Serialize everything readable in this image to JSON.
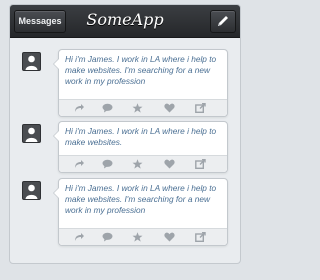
{
  "header": {
    "messages_label": "Messages",
    "app_title": "SomeApp",
    "edit_icon": "pencil-icon"
  },
  "feed": [
    {
      "text": "Hi i'm James. I work in LA where i help to make websites. I'm searching for a new work in my profession"
    },
    {
      "text": "Hi i'm James. I work in LA where i help to make websites."
    },
    {
      "text": "Hi i'm James. I work in LA where i help to make websites. I'm searching for a new work in my profession"
    }
  ],
  "actions": [
    "reply-icon",
    "comment-icon",
    "star-icon",
    "heart-icon",
    "share-icon"
  ],
  "colors": {
    "header": "#2e3134",
    "message_text": "#4a6f93",
    "action_icon": "#9ea4aa",
    "background": "#e9ecef"
  }
}
